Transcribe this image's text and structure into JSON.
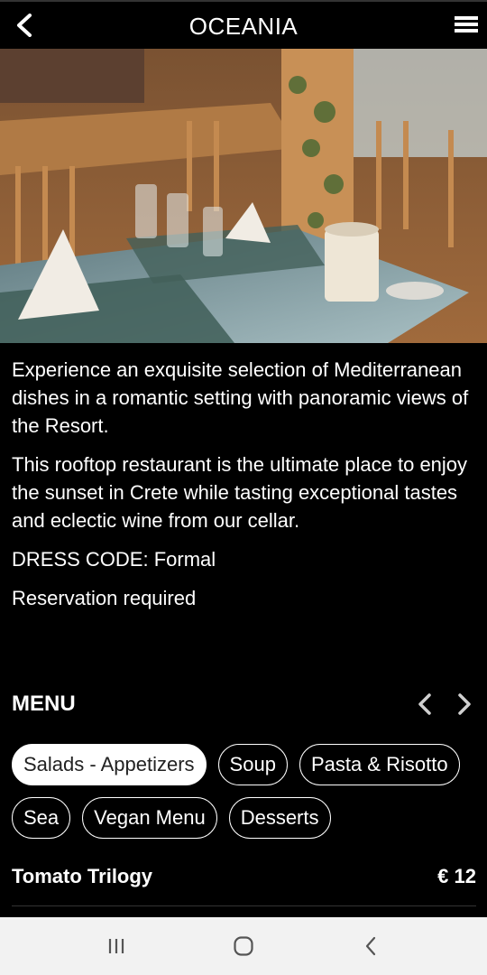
{
  "header": {
    "title": "OCEANIA",
    "back_icon": "chevron-left-icon",
    "menu_icon": "hamburger-icon"
  },
  "hero": {
    "image": "restaurant-table-photo"
  },
  "description": {
    "paragraphs": [
      "Experience an exquisite selection of Mediterranean dishes in a romantic setting with panoramic views of the Resort.",
      "This rooftop restaurant is the ultimate place to enjoy the sunset in Crete while tasting exceptional tastes and eclectic wine from our cellar.",
      "DRESS CODE: Formal",
      "Reservation required"
    ]
  },
  "menu": {
    "label": "MENU",
    "categories": [
      {
        "label": "Salads - Appetizers",
        "active": true
      },
      {
        "label": "Soup",
        "active": false
      },
      {
        "label": "Pasta & Risotto",
        "active": false
      },
      {
        "label": "Sea",
        "active": false
      },
      {
        "label": "Vegan Menu",
        "active": false
      },
      {
        "label": "Desserts",
        "active": false
      }
    ],
    "items": [
      {
        "name": "Tomato Trilogy",
        "price": "€ 12"
      }
    ]
  },
  "colors": {
    "background": "#000000",
    "text": "#ffffff",
    "navbar": "#f2f2f2"
  }
}
